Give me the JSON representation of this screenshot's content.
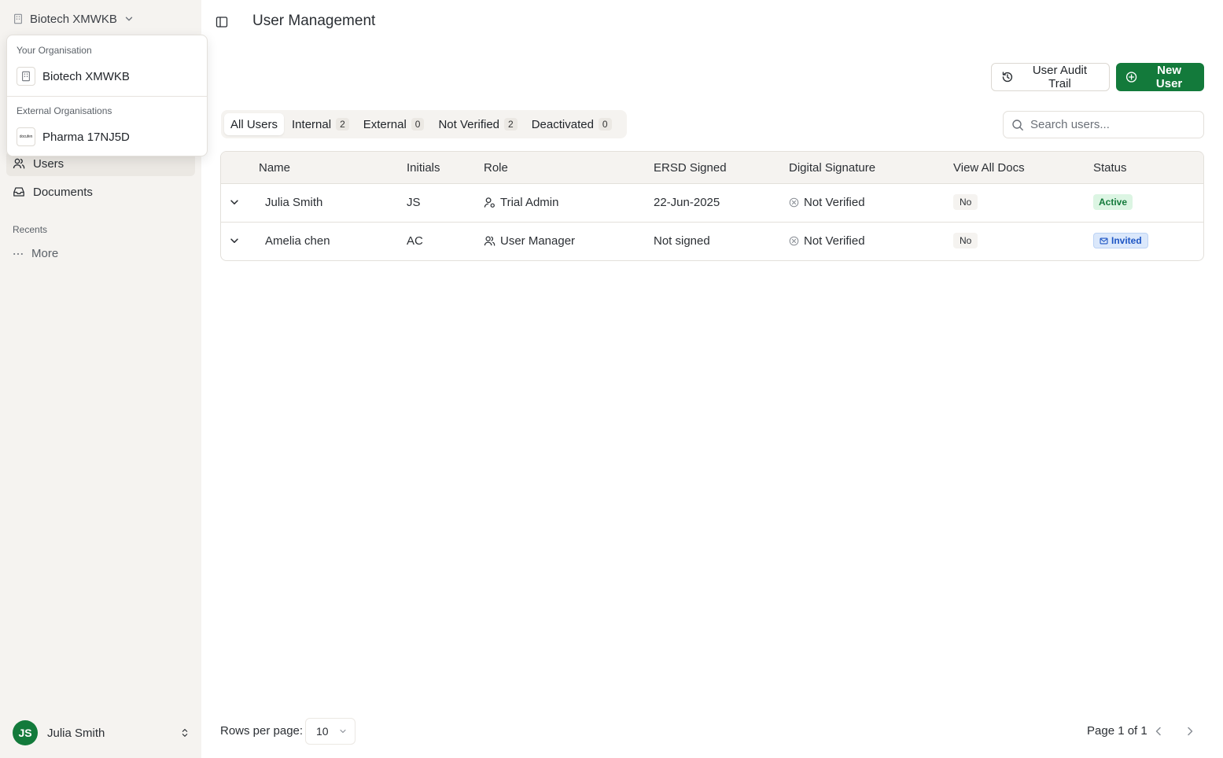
{
  "sidebar": {
    "org_name": "Biotech XMWKB",
    "nav": [
      {
        "label": "Users",
        "active": true
      },
      {
        "label": "Documents",
        "active": false
      }
    ],
    "recents_label": "Recents",
    "more_label": "More",
    "user": {
      "initials": "JS",
      "name": "Julia Smith",
      "avatar_color": "#137a3b"
    }
  },
  "org_dropdown": {
    "your_org_label": "Your Organisation",
    "your_org": "Biotech XMWKB",
    "external_label": "External Organisations",
    "external_orgs": [
      {
        "name": "Pharma 17NJ5D",
        "logo_text": "docufen"
      }
    ]
  },
  "header": {
    "title": "User Management",
    "audit_button": "User Audit Trail",
    "new_user_button": "New User"
  },
  "tabs": [
    {
      "label": "All Users",
      "count": null,
      "active": true
    },
    {
      "label": "Internal",
      "count": "2"
    },
    {
      "label": "External",
      "count": "0"
    },
    {
      "label": "Not Verified",
      "count": "2"
    },
    {
      "label": "Deactivated",
      "count": "0"
    }
  ],
  "search": {
    "placeholder": "Search users..."
  },
  "table": {
    "columns": [
      "Name",
      "Initials",
      "Role",
      "ERSD Signed",
      "Digital Signature",
      "View All Docs",
      "Status"
    ],
    "rows": [
      {
        "name": "Julia Smith",
        "initials": "JS",
        "role": "Trial Admin",
        "ersd": "22-Jun-2025",
        "digital_signature": "Not Verified",
        "view_all_docs": "No",
        "status": "Active"
      },
      {
        "name": "Amelia chen",
        "initials": "AC",
        "role": "User Manager",
        "ersd": "Not signed",
        "digital_signature": "Not Verified",
        "view_all_docs": "No",
        "status": "Invited"
      }
    ]
  },
  "pagination": {
    "rows_per_page_label": "Rows per page:",
    "rows_per_page": "10",
    "page_info": "Page 1 of 1"
  },
  "colors": {
    "brand": "#137a3b",
    "sidebar_bg": "#f5f3f0",
    "invited": "#1d55c4"
  }
}
